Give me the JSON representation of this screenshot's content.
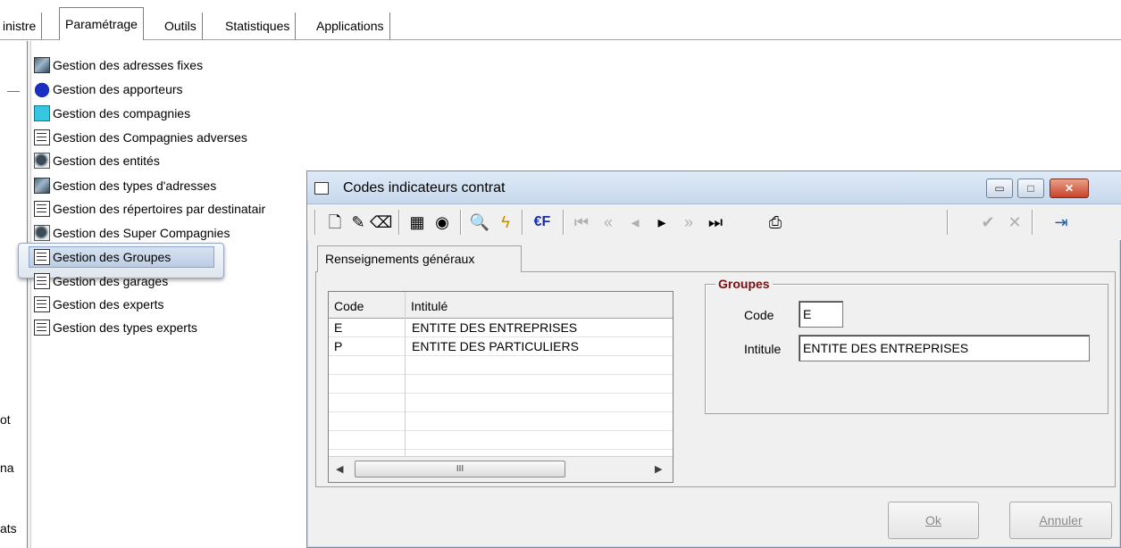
{
  "tabs": [
    {
      "label": "inistre",
      "active": false
    },
    {
      "label": "Paramétrage",
      "active": true
    },
    {
      "label": "Outils",
      "active": false
    },
    {
      "label": "Statistiques",
      "active": false
    },
    {
      "label": "Applications",
      "active": false
    }
  ],
  "left_cut": {
    "t1": "ot",
    "t2": "na",
    "t3": "ats"
  },
  "tree": [
    {
      "label": "Gestion des adresses fixes",
      "icon": "address-book-icon"
    },
    {
      "label": "Gestion des apporteurs",
      "icon": "people-icon"
    },
    {
      "label": "Gestion des compagnies",
      "icon": "company-icon"
    },
    {
      "label": "Gestion des Compagnies adverses",
      "icon": "list-icon"
    },
    {
      "label": "Gestion des entités",
      "icon": "entity-icon"
    },
    {
      "label": "Gestion des types d'adresses",
      "icon": "address-book-icon"
    },
    {
      "label": "Gestion des répertoires par destinatair",
      "icon": "list-icon"
    },
    {
      "label": "Gestion des Super Compagnies",
      "icon": "entity-icon"
    },
    {
      "label": "Gestion des Groupes",
      "icon": "list-icon",
      "selected": true
    },
    {
      "label": "Gestion des garages",
      "icon": "list-icon"
    },
    {
      "label": "Gestion des experts",
      "icon": "list-icon"
    },
    {
      "label": "Gestion des types experts",
      "icon": "list-icon"
    }
  ],
  "dialog": {
    "title": "Codes indicateurs contrat",
    "tab_label": "Renseignements généraux",
    "grid": {
      "columns": [
        "Code",
        "Intitulé"
      ],
      "rows": [
        {
          "code": "E",
          "intitule": "ENTITE DES ENTREPRISES"
        },
        {
          "code": "P",
          "intitule": "ENTITE DES PARTICULIERS"
        }
      ],
      "scroll_thumb": "III"
    },
    "groupbox": {
      "title": "Groupes",
      "code_label": "Code",
      "code_value": "E",
      "intitule_label": "Intitule",
      "intitule_value": "ENTITE DES ENTREPRISES"
    },
    "buttons": {
      "ok": "Ok",
      "cancel": "Annuler"
    },
    "winbtns": {
      "min": "▭",
      "max": "□",
      "close": "✕"
    }
  },
  "toolbar": {
    "new": "🗋",
    "edit": "✎",
    "erase": "⌫",
    "grid": "▦",
    "camera": "◉",
    "search": "🔍",
    "flash": "ϟ",
    "euro": "€F",
    "first": "⏮",
    "prevfast": "«",
    "prev": "◂",
    "next": "▸",
    "nextfast": "»",
    "last": "⏭",
    "print": "⎙",
    "validate": "✔",
    "cancel": "✕",
    "exit": "⇥"
  },
  "colors": {
    "groupbox_title": "#7a0f0f",
    "close_button": "#c8432a"
  }
}
